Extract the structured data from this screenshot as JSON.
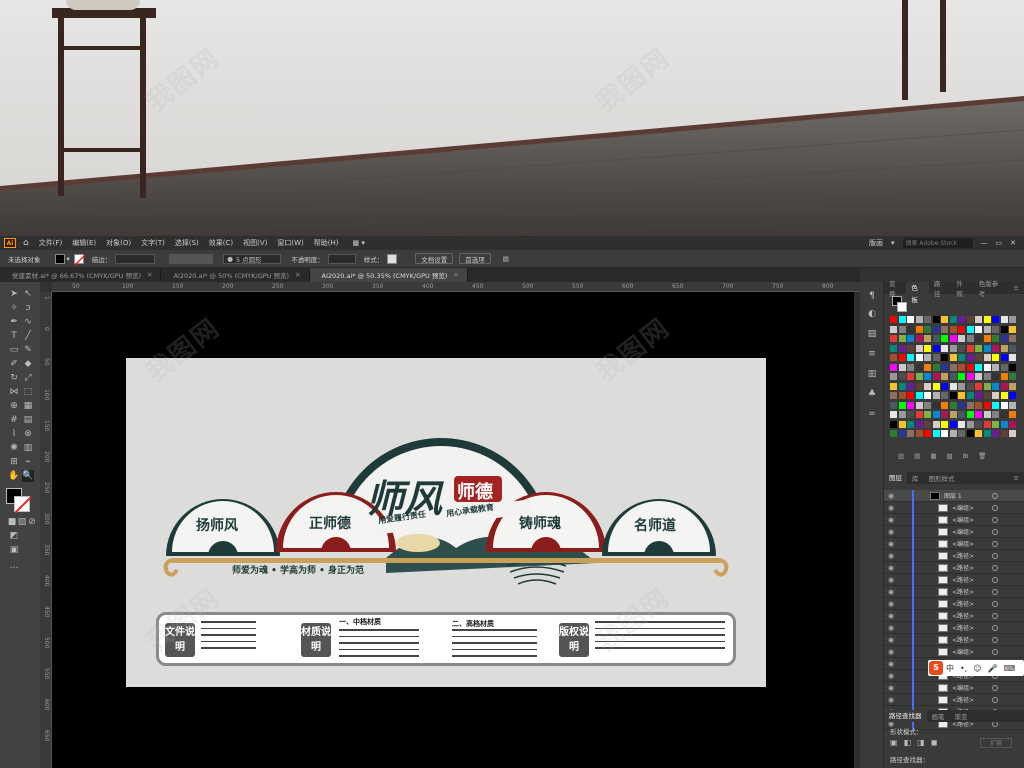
{
  "menu": {
    "items": [
      "文件(F)",
      "编辑(E)",
      "对象(O)",
      "文字(T)",
      "选择(S)",
      "效果(C)",
      "视图(V)",
      "窗口(W)",
      "帮助(H)"
    ],
    "workspace": "版画",
    "stock_search": "搜索 Adobe Stock"
  },
  "control_bar": {
    "selection": "未选择对象",
    "stroke_label": "描边：",
    "brush": "5 点圆形",
    "opacity_label": "不透明度：",
    "style_label": "样式：",
    "doc_setup": "文档设置",
    "preferences": "首选项"
  },
  "tabs": [
    {
      "label": "党建素材.ai* @ 66.67% (CMYK/GPU 预览)",
      "active": false
    },
    {
      "label": "AI2020.ai* @ 50% (CMYK/GPU 预览)",
      "active": false
    },
    {
      "label": "AI2020.ai* @ 50.35% (CMYK/GPU 预览)",
      "active": true
    }
  ],
  "ruler": {
    "top": [
      "50",
      "100",
      "150",
      "200",
      "250",
      "300",
      "350",
      "400",
      "450",
      "500",
      "550",
      "600",
      "650",
      "700",
      "750",
      "800"
    ],
    "left": [
      "1",
      "0",
      "50",
      "100",
      "150",
      "200",
      "250",
      "300",
      "350",
      "400",
      "450",
      "500",
      "550",
      "600",
      "650"
    ]
  },
  "artwork": {
    "title_main": "师风",
    "title_seal": "师德",
    "slogan_left": "用爱履行责任",
    "slogan_right": "用心承载教育",
    "fans": [
      "扬师风",
      "正师德",
      "铸师魂",
      "名师道"
    ],
    "motto": "师爱为魂 • 学高为师 • 身正为范",
    "info": {
      "box1": "文件说明",
      "box2": "材质说明",
      "mid_head": "一、中档材质",
      "high_head": "二、高档材质",
      "box3": "版权说明"
    },
    "colors": {
      "green": "#1f3b39",
      "red": "#8c1d1d",
      "gold": "#c9a15a"
    }
  },
  "panel": {
    "top_tabs": [
      "变换",
      "色板",
      "路径",
      "外观",
      "色版参考"
    ],
    "layer_tabs": [
      "图层",
      "库",
      "图形样式"
    ],
    "bottom_tabs": [
      "路径查找器",
      "画笔",
      "渐变"
    ],
    "pathfinder_shape": "形状模式：",
    "pathfinder_find": "路径查找器：",
    "expand": "扩展",
    "layers": [
      {
        "name": "图层 1",
        "top": true
      },
      {
        "name": "<编组>"
      },
      {
        "name": "<编组>"
      },
      {
        "name": "<编组>"
      },
      {
        "name": "<编组>"
      },
      {
        "name": "<路径>"
      },
      {
        "name": "<路径>"
      },
      {
        "name": "<路径>"
      },
      {
        "name": "<路径>"
      },
      {
        "name": "<路径>"
      },
      {
        "name": "<路径>"
      },
      {
        "name": "<路径>"
      },
      {
        "name": "<路径>"
      },
      {
        "name": "<编组>"
      },
      {
        "name": "<路径>"
      },
      {
        "name": "<路径>"
      },
      {
        "name": "<编组>"
      },
      {
        "name": "<路径>"
      },
      {
        "name": "<路径>"
      },
      {
        "name": "<路径>"
      }
    ]
  },
  "ime": "中"
}
